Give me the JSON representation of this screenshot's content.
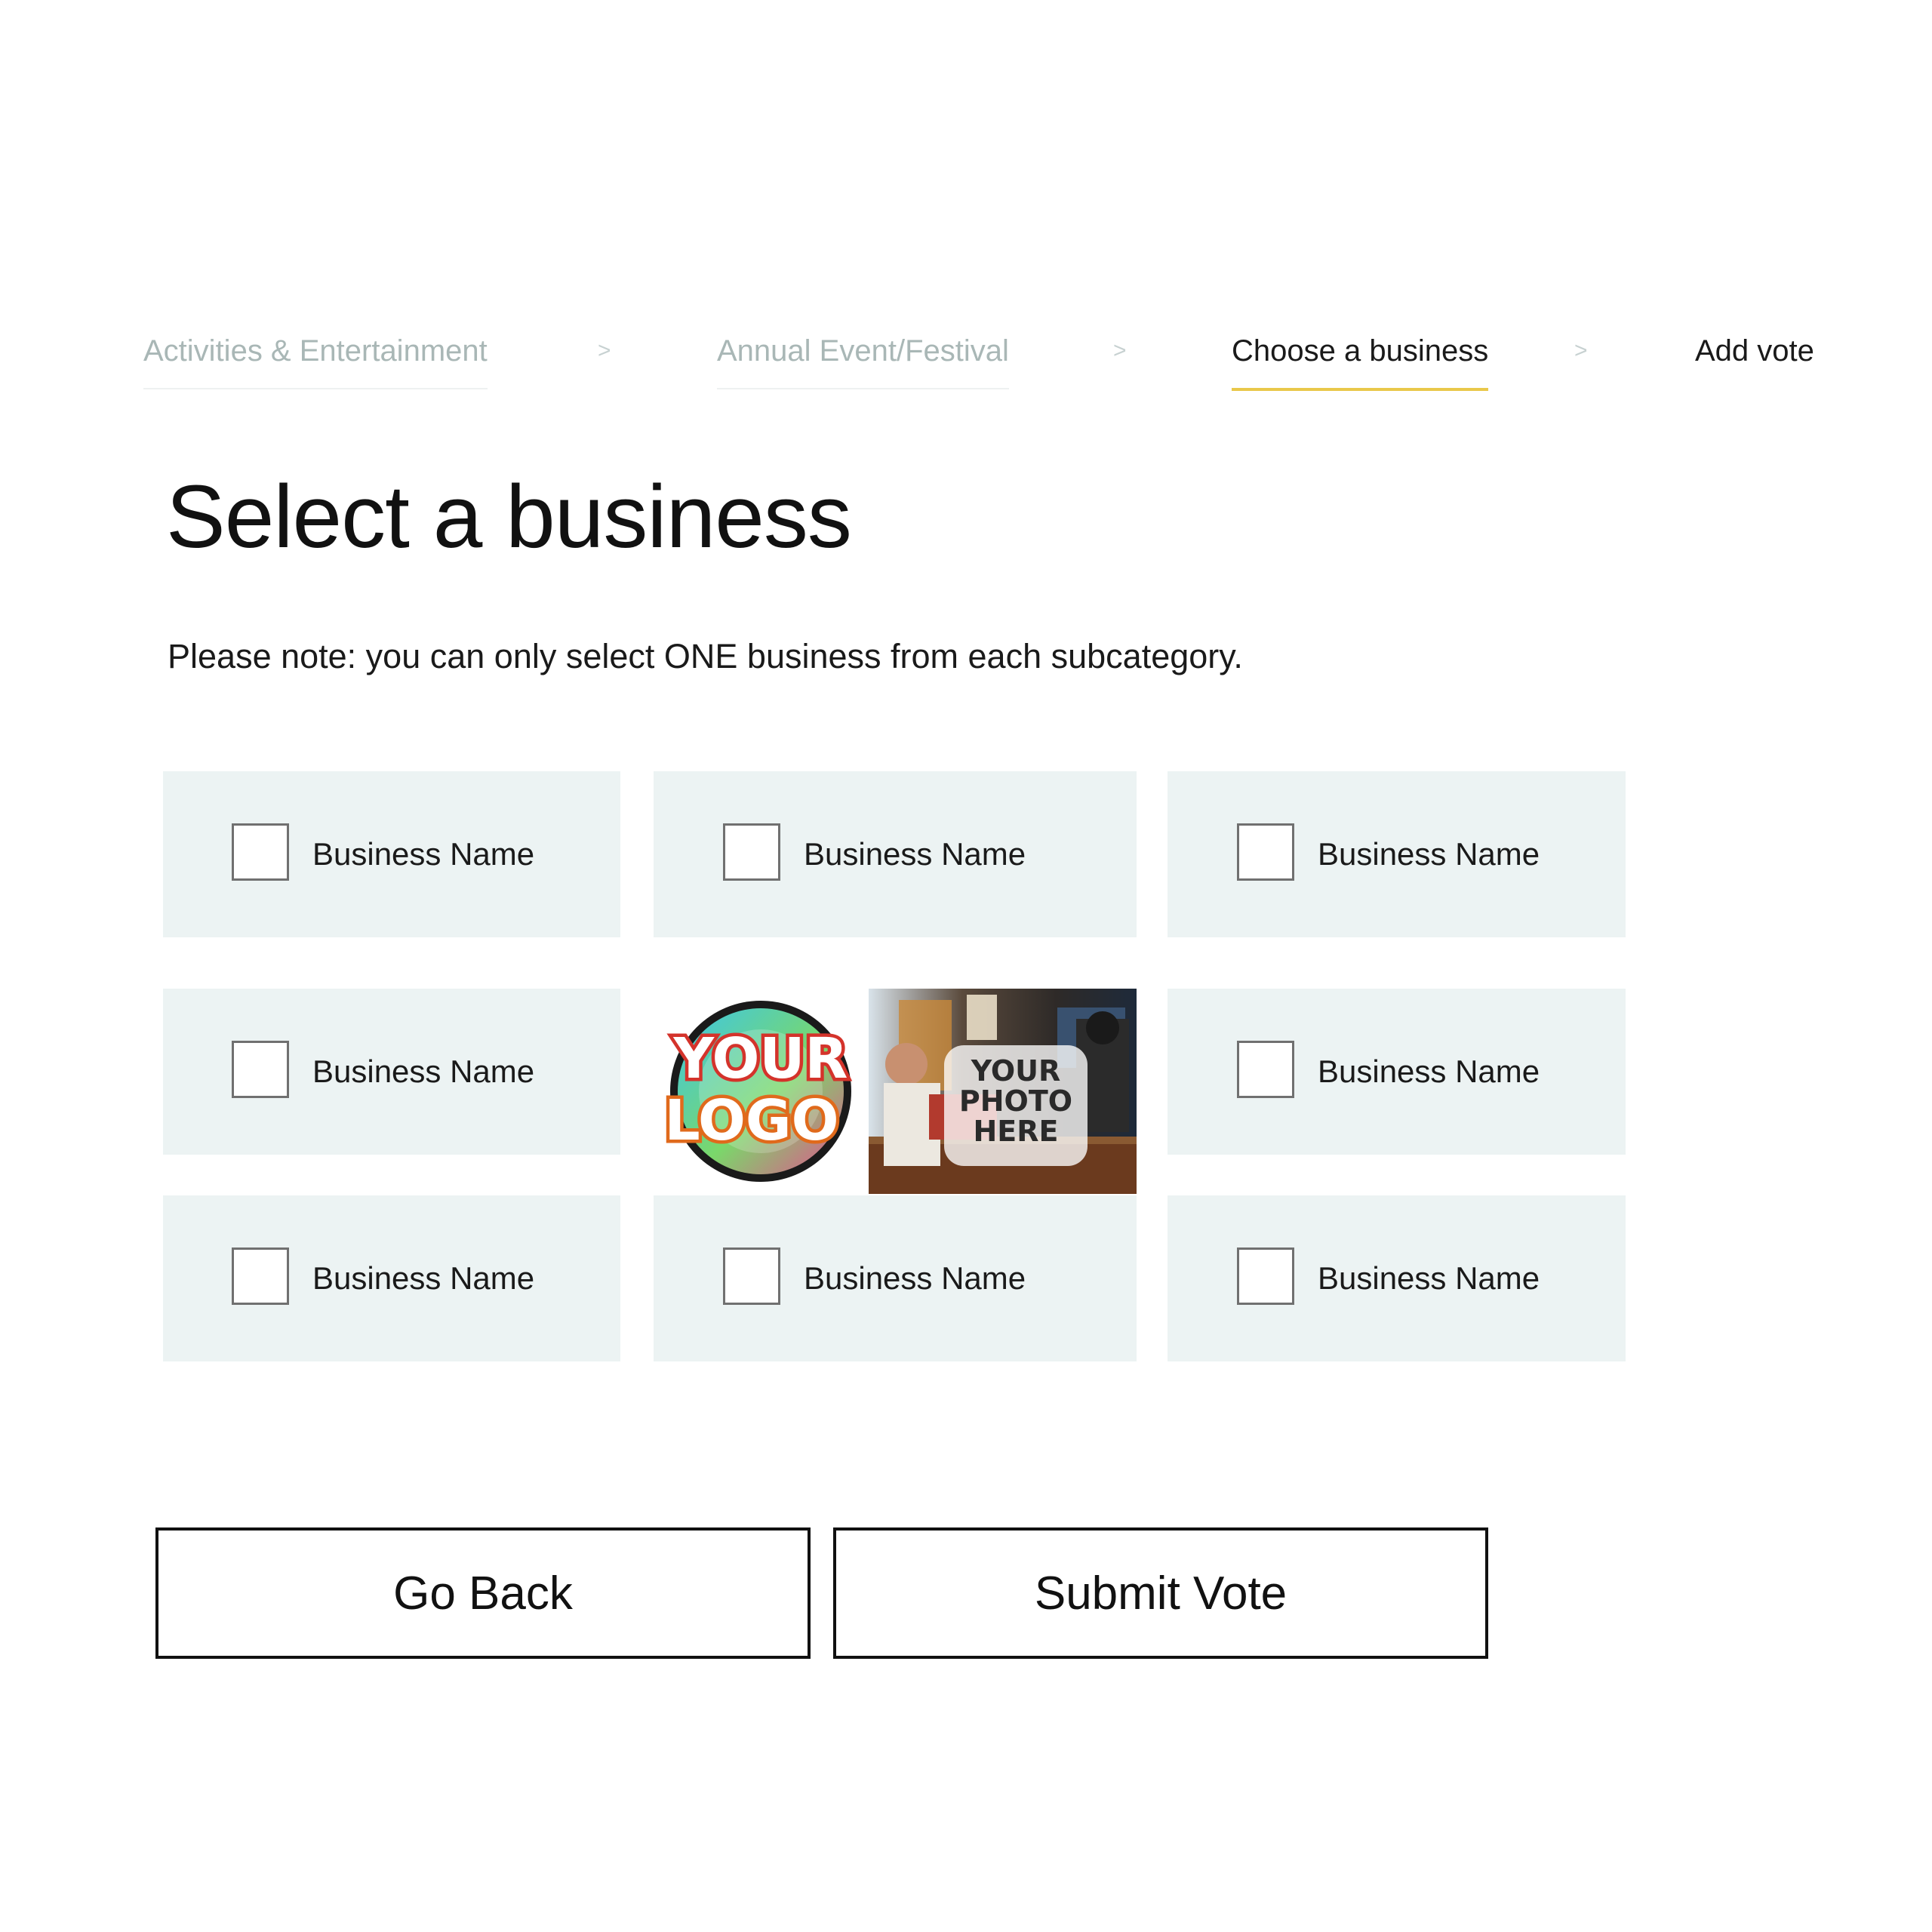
{
  "stepper": {
    "steps": [
      {
        "label": "Activities & Entertainment",
        "state": "done"
      },
      {
        "label": "Annual Event/Festival",
        "state": "done"
      },
      {
        "label": "Choose a business",
        "state": "active"
      },
      {
        "label": "Add vote",
        "state": "todo"
      }
    ],
    "separator": ">"
  },
  "main": {
    "title": "Select a business",
    "note": "Please note: you can only select ONE business from each subcategory."
  },
  "businesses": [
    {
      "label": "Business Name",
      "checked": false
    },
    {
      "label": "Business Name",
      "checked": false
    },
    {
      "label": "Business Name",
      "checked": false
    },
    {
      "label": "Business Name",
      "checked": false
    },
    {
      "label": "Business Name",
      "checked": false
    },
    {
      "label": "Business Name",
      "checked": false
    },
    {
      "label": "Business Name",
      "checked": false
    },
    {
      "label": "Business Name",
      "checked": false
    }
  ],
  "promo": {
    "logo_text": [
      "YOUR",
      "LOGO"
    ],
    "photo_text": [
      "YOUR",
      "PHOTO",
      "HERE"
    ]
  },
  "actions": {
    "back_label": "Go Back",
    "submit_label": "Submit Vote"
  },
  "colors": {
    "card_background": "#ecf3f3",
    "active_step_underline": "#e9c84a",
    "inactive_step_text": "#a9b7b6",
    "text": "#111111"
  }
}
